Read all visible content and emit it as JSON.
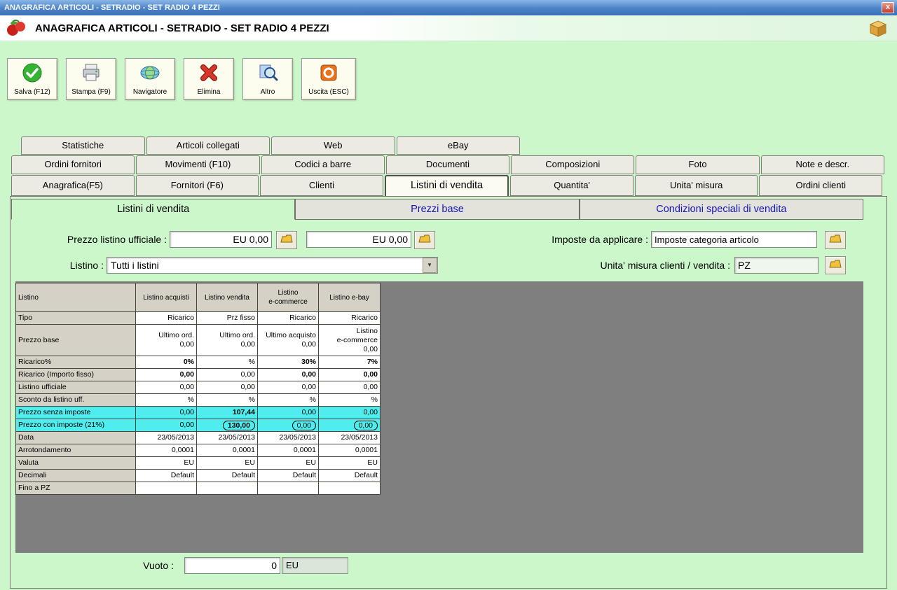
{
  "window": {
    "title": "ANAGRAFICA ARTICOLI - SETRADIO - SET RADIO 4 PEZZI",
    "close_glyph": "x"
  },
  "colors": {
    "highlight_cyan": "#4FEDED",
    "background_green": "#CBF7CB",
    "titlebar_blue": "#4B82C8"
  },
  "toolbar": {
    "buttons": [
      {
        "label": "Salva (F12)",
        "icon": "save-check-icon"
      },
      {
        "label": "Stampa (F9)",
        "icon": "printer-icon"
      },
      {
        "label": "Navigatore",
        "icon": "navigator-globe-icon"
      },
      {
        "label": "Elimina",
        "icon": "delete-x-icon"
      },
      {
        "label": "Altro",
        "icon": "magnifier-icon"
      },
      {
        "label": "Uscita (ESC)",
        "icon": "exit-icon"
      }
    ]
  },
  "tabs": {
    "row1": [
      "Statistiche",
      "Articoli collegati",
      "Web",
      "eBay"
    ],
    "row2": [
      "Ordini fornitori",
      "Movimenti (F10)",
      "Codici a barre",
      "Documenti",
      "Composizioni",
      "Foto",
      "Note e descr."
    ],
    "row3": [
      "Anagrafica(F5)",
      "Fornitori (F6)",
      "Clienti",
      "Listini di vendita",
      "Quantita'",
      "Unita' misura",
      "Ordini clienti"
    ],
    "row3_selected_index": 3
  },
  "subtabs": {
    "items": [
      "Listini di vendita",
      "Prezzi base",
      "Condizioni speciali di vendita"
    ],
    "selected_index": 0
  },
  "form": {
    "prezzo_listino_label": "Prezzo listino ufficiale :",
    "prezzo_value_1": "EU 0,00",
    "prezzo_value_2": "EU 0,00",
    "imposte_label": "Imposte da applicare :",
    "imposte_value": "Imposte categoria articolo",
    "listino_label": "Listino :",
    "listino_value": "Tutti i listini",
    "um_label": "Unita' misura clienti / vendita :",
    "um_value": "PZ"
  },
  "grid": {
    "corner": "Listino",
    "columns": [
      "Listino acquisti",
      "Listino vendita",
      "Listino\ne-commerce",
      "Listino e-bay"
    ],
    "rows": [
      {
        "label": "Tipo",
        "cells": [
          "Ricarico",
          "Prz fisso",
          "Ricarico",
          "Ricarico"
        ]
      },
      {
        "label": "Prezzo base",
        "tall": true,
        "cells": [
          "Ultimo ord.\n0,00",
          "Ultimo ord.\n0,00",
          "Ultimo acquisto\n0,00",
          "Listino\ne-commerce\n0,00"
        ]
      },
      {
        "label": "Ricarico%",
        "bold": [
          1,
          0,
          1,
          1
        ],
        "cells": [
          "0%",
          "%",
          "30%",
          "7%"
        ]
      },
      {
        "label": "Ricarico (Importo fisso)",
        "bold": [
          1,
          0,
          1,
          1
        ],
        "cells": [
          "0,00",
          "0,00",
          "0,00",
          "0,00"
        ]
      },
      {
        "label": "Listino ufficiale",
        "cells": [
          "0,00",
          "0,00",
          "0,00",
          "0,00"
        ]
      },
      {
        "label": "Sconto da listino uff.",
        "cells": [
          "%",
          "%",
          "%",
          "%"
        ]
      },
      {
        "label": "Prezzo senza imposte",
        "highlight": true,
        "bold": [
          0,
          1,
          0,
          0
        ],
        "cells": [
          "0,00",
          "107,44",
          "0,00",
          "0,00"
        ]
      },
      {
        "label": "Prezzo con imposte (21%)",
        "highlight": true,
        "bold": [
          0,
          1,
          0,
          0
        ],
        "circled": [
          0,
          1,
          1,
          1
        ],
        "cells": [
          "0,00",
          "130,00",
          "0,00",
          "0,00"
        ]
      },
      {
        "label": "Data",
        "cells": [
          "23/05/2013",
          "23/05/2013",
          "23/05/2013",
          "23/05/2013"
        ]
      },
      {
        "label": "Arrotondamento",
        "cells": [
          "0,0001",
          "0,0001",
          "0,0001",
          "0,0001"
        ]
      },
      {
        "label": "Valuta",
        "cells": [
          "EU",
          "EU",
          "EU",
          "EU"
        ]
      },
      {
        "label": "Decimali",
        "cells": [
          "Default",
          "Default",
          "Default",
          "Default"
        ]
      },
      {
        "label": "Fino a PZ",
        "cells": [
          "",
          "",
          "",
          ""
        ]
      }
    ]
  },
  "footer": {
    "vuoto_label": "Vuoto :",
    "vuoto_value": "0",
    "currency": "EU"
  }
}
